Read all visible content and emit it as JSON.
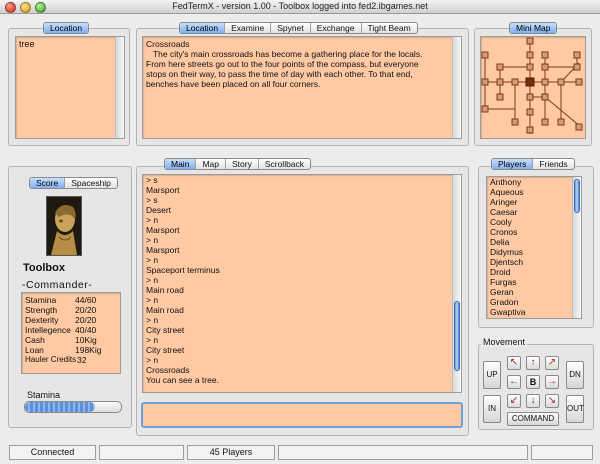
{
  "window": {
    "title": "FedTermX - version 1.00 - Toolbox logged into fed2.ibgames.net"
  },
  "location_panel": {
    "tab_label": "Location",
    "items": [
      "tree"
    ]
  },
  "info_panel": {
    "tabs": [
      {
        "label": "Location",
        "active": true
      },
      {
        "label": "Examine",
        "active": false
      },
      {
        "label": "Spynet",
        "active": false
      },
      {
        "label": "Exchange",
        "active": false
      },
      {
        "label": "Tight Beam",
        "active": false
      }
    ],
    "lines": [
      "Crossroads",
      "   The city's main crossroads has become a gathering place for the locals.",
      "From here streets go out to the four points of the compass, but everyone",
      "stops on their way, to pass the time of day with each other. To that end,",
      "benches have been placed on all four corners."
    ]
  },
  "minimap": {
    "tab_label": "Mini Map"
  },
  "main_panel": {
    "tabs": [
      {
        "label": "Main",
        "active": true
      },
      {
        "label": "Map",
        "active": false
      },
      {
        "label": "Story",
        "active": false
      },
      {
        "label": "Scrollback",
        "active": false
      }
    ],
    "lines": [
      "> s",
      "Marsport",
      "> s",
      "Desert",
      "> n",
      "Marsport",
      "> n",
      "Marsport",
      "> n",
      "Spaceport terminus",
      "> n",
      "Main road",
      "> n",
      "Main road",
      "> n",
      "City street",
      "> n",
      "City street",
      "> n",
      "Crossroads",
      "You can see a tree."
    ],
    "command_input": ""
  },
  "score_panel": {
    "tabs": [
      {
        "label": "Score",
        "active": true
      },
      {
        "label": "Spaceship",
        "active": false
      }
    ],
    "player_name": "Toolbox",
    "rank": "-Commander-",
    "stats": [
      {
        "key": "Stamina",
        "value": "44/60"
      },
      {
        "key": "Strength",
        "value": "20/20"
      },
      {
        "key": "Dexterity",
        "value": "20/20"
      },
      {
        "key": "Intellegence",
        "value": "40/40"
      },
      {
        "key": "Cash",
        "value": "10Kig"
      },
      {
        "key": "Loan",
        "value": "198Kig"
      },
      {
        "key": "Hauler Credits",
        "value": "32"
      }
    ],
    "stamina_label": "Stamina",
    "stamina_fraction": 0.73
  },
  "players_panel": {
    "tabs": [
      {
        "label": "Players",
        "active": true
      },
      {
        "label": "Friends",
        "active": false
      }
    ],
    "players": [
      "Anthony",
      "Aqueous",
      "Aringer",
      "Caesar",
      "Cooly",
      "Cronos",
      "Delia",
      "Didymus",
      "Djentsch",
      "Droid",
      "Furgas",
      "Geran",
      "Gradon",
      "Gwaptiva"
    ]
  },
  "movement": {
    "title": "Movement",
    "up": "UP",
    "dn": "DN",
    "in": "IN",
    "out": "OUT",
    "center": "B",
    "command": "COMMAND",
    "arrows": [
      "nw-arrow-icon",
      "n-arrow-icon",
      "ne-arrow-icon",
      "w-arrow-icon",
      "e-arrow-icon",
      "sw-arrow-icon",
      "s-arrow-icon",
      "se-arrow-icon"
    ]
  },
  "status_bar": {
    "connection": "Connected",
    "players_count": "45 Players",
    "cell2": "",
    "cell4": "",
    "cell5": ""
  },
  "colors": {
    "peach": "#ffc9a4",
    "accent": "#7fb0ee",
    "map_line": "#7a3a1a"
  }
}
